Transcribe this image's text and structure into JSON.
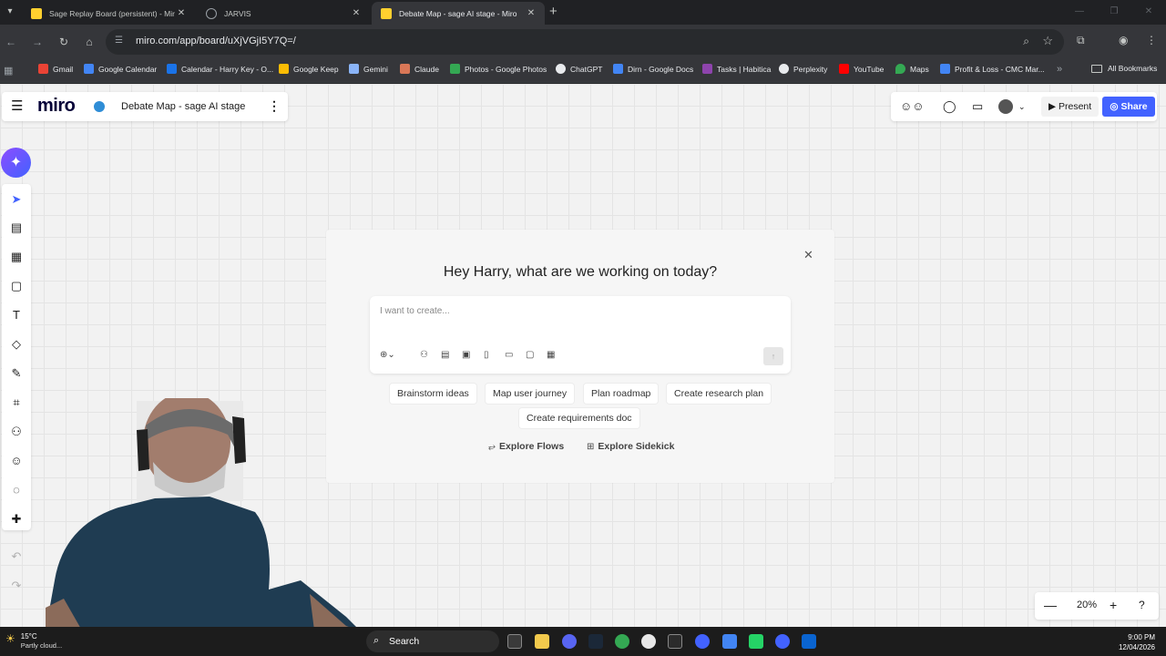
{
  "browser": {
    "tabs": [
      {
        "label": "Sage Replay Board (persistent) - Miro",
        "icon": "miro-icon",
        "active": false
      },
      {
        "label": "JARVIS",
        "icon": "globe-icon",
        "active": false
      },
      {
        "label": "Debate Map - sage AI stage - Miro",
        "icon": "miro-icon",
        "active": true
      }
    ],
    "url": "miro.com/app/board/uXjVGjI5Y7Q=/",
    "bookmarks": [
      {
        "label": "Gmail",
        "color": "#ea4335"
      },
      {
        "label": "Google Calendar",
        "color": "#4285f4"
      },
      {
        "label": "Calendar - Harry Key - O...",
        "color": "#1a73e8"
      },
      {
        "label": "Google Keep",
        "color": "#fbbc04"
      },
      {
        "label": "Gemini",
        "color": "#8ab4f8"
      },
      {
        "label": "Claude",
        "color": "#d97757"
      },
      {
        "label": "Photos - Google Photos",
        "color": "#34a853"
      },
      {
        "label": "ChatGPT",
        "color": "#e8eaed"
      },
      {
        "label": "Dirn - Google Docs",
        "color": "#4285f4"
      },
      {
        "label": "Tasks | Habitica",
        "color": "#8e44ad"
      },
      {
        "label": "Perplexity",
        "color": "#e8eaed"
      },
      {
        "label": "YouTube",
        "color": "#ff0000"
      },
      {
        "label": "Maps",
        "color": "#34a853"
      },
      {
        "label": "Profit & Loss - CMC Mar...",
        "color": "#4285f4"
      }
    ],
    "all_bookmarks": "All Bookmarks"
  },
  "miro": {
    "logo": "miro",
    "board_title": "Debate Map - sage AI stage",
    "present_label": "Present",
    "share_label": "Share",
    "zoom": "20%",
    "ai_panel": {
      "greeting": "Hey Harry, what are we working on today?",
      "placeholder": "I want to create...",
      "chips": [
        "Brainstorm ideas",
        "Map user journey",
        "Plan roadmap",
        "Create research plan",
        "Create requirements doc"
      ],
      "explore_flows": "Explore Flows",
      "explore_sidekick": "Explore Sidekick"
    }
  },
  "taskbar": {
    "temperature": "15°C",
    "weather": "Partly cloud...",
    "search": "Search",
    "time": "9:00 PM",
    "date": "12/04/2026"
  }
}
